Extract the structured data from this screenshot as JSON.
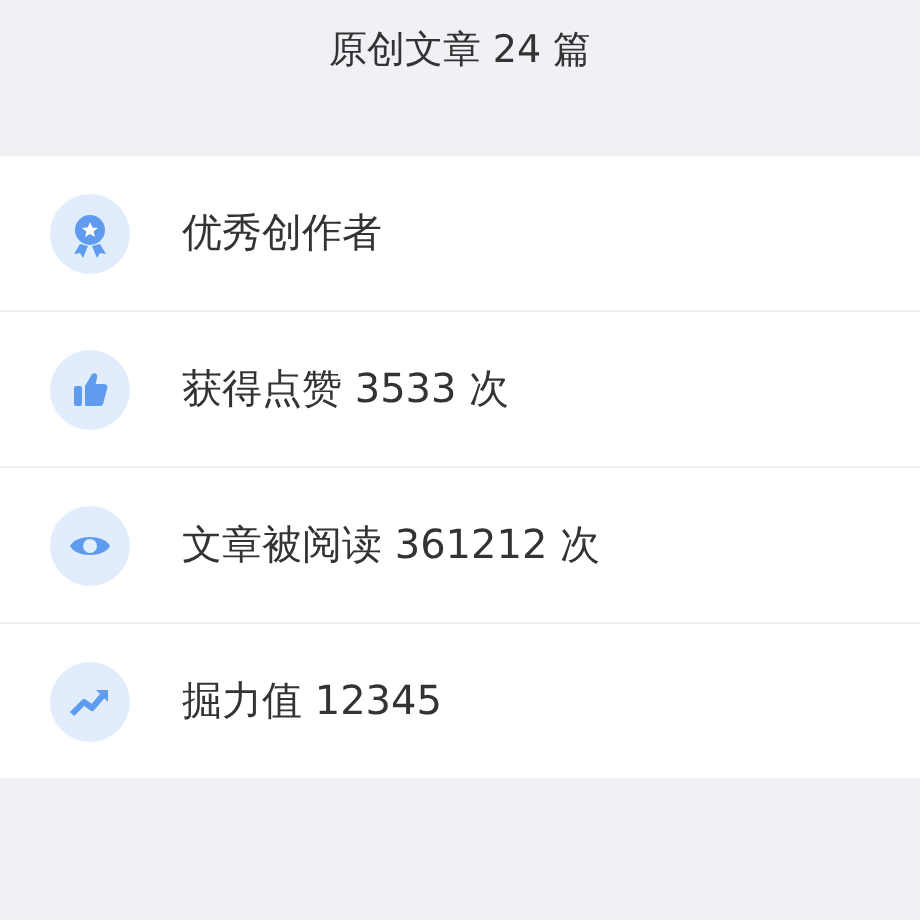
{
  "header": {
    "title": "原创文章 24 篇"
  },
  "stats": [
    {
      "kind": "medal",
      "text": "优秀创作者"
    },
    {
      "kind": "like",
      "text": "获得点赞 3533 次"
    },
    {
      "kind": "view",
      "text": "文章被阅读 361212 次"
    },
    {
      "kind": "trend",
      "text": "掘力值 12345"
    }
  ]
}
